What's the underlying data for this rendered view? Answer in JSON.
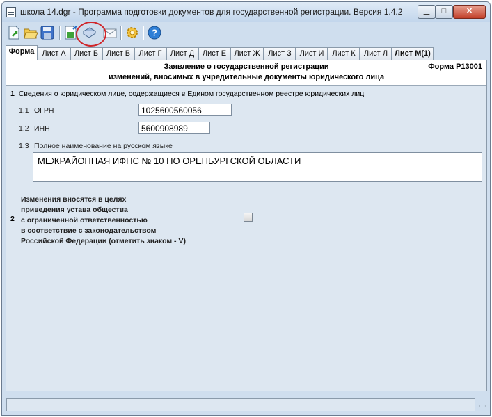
{
  "window": {
    "title": "школа 14.dgr - Программа подготовки документов для государственной регистрации. Версия 1.4.2",
    "min_label": "▁",
    "max_label": "□",
    "close_label": "✕"
  },
  "toolbar": {
    "icons": [
      "new-doc-icon",
      "open-folder-icon",
      "save-disk-icon",
      "export-doc-icon",
      "print-send-icon",
      "envelope-icon",
      "settings-gear-icon",
      "help-icon"
    ],
    "highlighted": "print-send-icon",
    "highlight_color": "#d0262a"
  },
  "tabs": [
    {
      "label": "Форма",
      "active": true
    },
    {
      "label": "Лист А"
    },
    {
      "label": "Лист Б"
    },
    {
      "label": "Лист В"
    },
    {
      "label": "Лист Г"
    },
    {
      "label": "Лист Д"
    },
    {
      "label": "Лист Е"
    },
    {
      "label": "Лист Ж"
    },
    {
      "label": "Лист З"
    },
    {
      "label": "Лист И"
    },
    {
      "label": "Лист К"
    },
    {
      "label": "Лист Л"
    },
    {
      "label": "Лист М(1)",
      "bold": true
    }
  ],
  "form": {
    "code": "Форма Р13001",
    "heading_line1": "Заявление о государственной регистрации",
    "heading_line2": "изменений, вносимых в учредительные документы юридического лица",
    "section1": {
      "number": "1",
      "title": "Сведения о юридическом лице, содержащиеся в Едином государственном реестре юридических лиц",
      "ogrn": {
        "number": "1.1",
        "label": "ОГРН",
        "value": "1025600560056"
      },
      "inn": {
        "number": "1.2",
        "label": "ИНН",
        "value": "5600908989"
      },
      "name": {
        "number": "1.3",
        "label": "Полное наименование на русском языке",
        "value": "МЕЖРАЙОННАЯ ИФНС № 10 ПО ОРЕНБУРГСКОЙ ОБЛАСТИ"
      }
    },
    "section2": {
      "number": "2",
      "lines": [
        "Изменения вносятся в целях",
        "приведения устава общества",
        "с ограниченной ответственностью",
        "в соответствие с законодательством",
        "Российской Федерации (отметить знаком - V)"
      ],
      "checked": false
    }
  },
  "status": {
    "text": ""
  }
}
